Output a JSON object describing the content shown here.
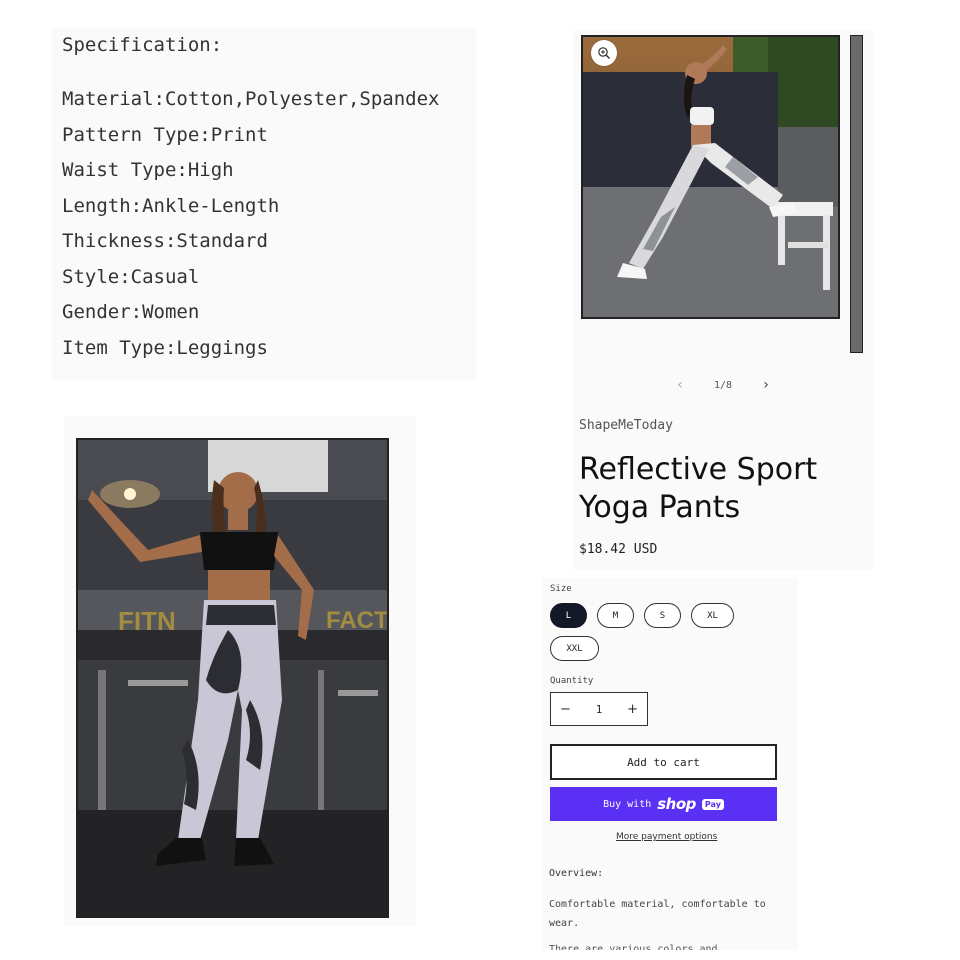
{
  "spec": {
    "title": "Specification:",
    "items": [
      "Material:Cotton,Polyester,Spandex",
      "Pattern Type:Print",
      "Waist Type:High",
      "Length:Ankle-Length",
      "Thickness:Standard",
      "Style:Casual",
      "Gender:Women",
      "Item Type:Leggings"
    ]
  },
  "gallery": {
    "zoom_icon": "magnifier-plus-icon",
    "pager": {
      "prev_icon": "chevron-left-icon",
      "next_icon": "chevron-right-icon",
      "count": "1/8"
    }
  },
  "product": {
    "vendor": "ShapeMeToday",
    "title": "Reflective Sport Yoga Pants",
    "price": "$18.42 USD"
  },
  "purchase": {
    "size_label": "Size",
    "sizes": [
      "L",
      "M",
      "S",
      "XL",
      "XXL"
    ],
    "selected_size": "L",
    "quantity_label": "Quantity",
    "quantity_value": "1",
    "decrease_symbol": "−",
    "increase_symbol": "+",
    "add_to_cart": "Add to cart",
    "buy_with": "Buy with",
    "shop_word": "shop",
    "pay_badge": "Pay",
    "more_payment": "More payment options",
    "overview_label": "Overview:",
    "overview_text": "Comfortable material, comfortable to wear.",
    "overview_cut": "There are various colors and"
  },
  "colors": {
    "shop_pay": "#5a31f4",
    "selected_size": "#121826",
    "panel_bg": "#fafafa"
  }
}
